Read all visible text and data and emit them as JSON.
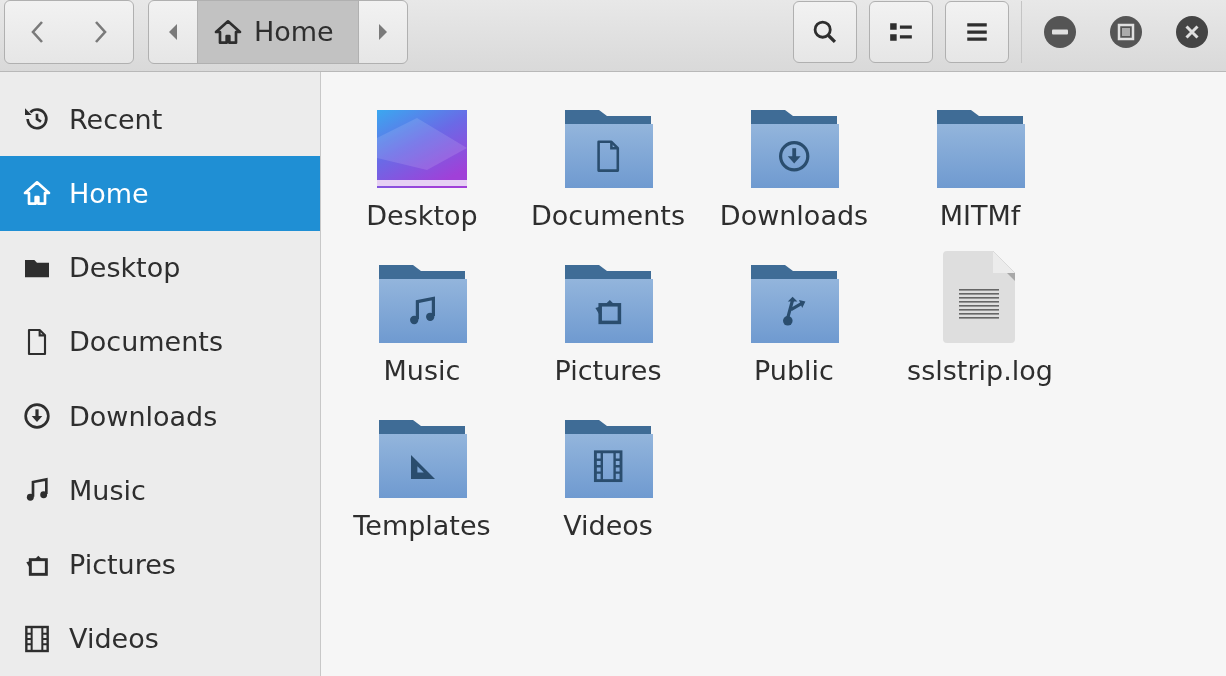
{
  "path_bar": {
    "crumbs": [
      {
        "label": "Home",
        "kind": "home",
        "selected": true
      }
    ]
  },
  "sidebar": {
    "items": [
      {
        "label": "Recent",
        "kind": "recent",
        "selected": false
      },
      {
        "label": "Home",
        "kind": "home",
        "selected": true
      },
      {
        "label": "Desktop",
        "kind": "desktop",
        "selected": false
      },
      {
        "label": "Documents",
        "kind": "documents",
        "selected": false
      },
      {
        "label": "Downloads",
        "kind": "downloads",
        "selected": false
      },
      {
        "label": "Music",
        "kind": "music",
        "selected": false
      },
      {
        "label": "Pictures",
        "kind": "pictures",
        "selected": false
      },
      {
        "label": "Videos",
        "kind": "videos",
        "selected": false
      }
    ]
  },
  "files": [
    {
      "name": "Desktop",
      "kind": "wallpaper"
    },
    {
      "name": "Documents",
      "kind": "documents"
    },
    {
      "name": "Downloads",
      "kind": "downloads"
    },
    {
      "name": "MITMf",
      "kind": "folder"
    },
    {
      "name": "Music",
      "kind": "music"
    },
    {
      "name": "Pictures",
      "kind": "pictures"
    },
    {
      "name": "Public",
      "kind": "public"
    },
    {
      "name": "sslstrip.log",
      "kind": "textfile"
    },
    {
      "name": "Templates",
      "kind": "templates"
    },
    {
      "name": "Videos",
      "kind": "videos"
    }
  ]
}
